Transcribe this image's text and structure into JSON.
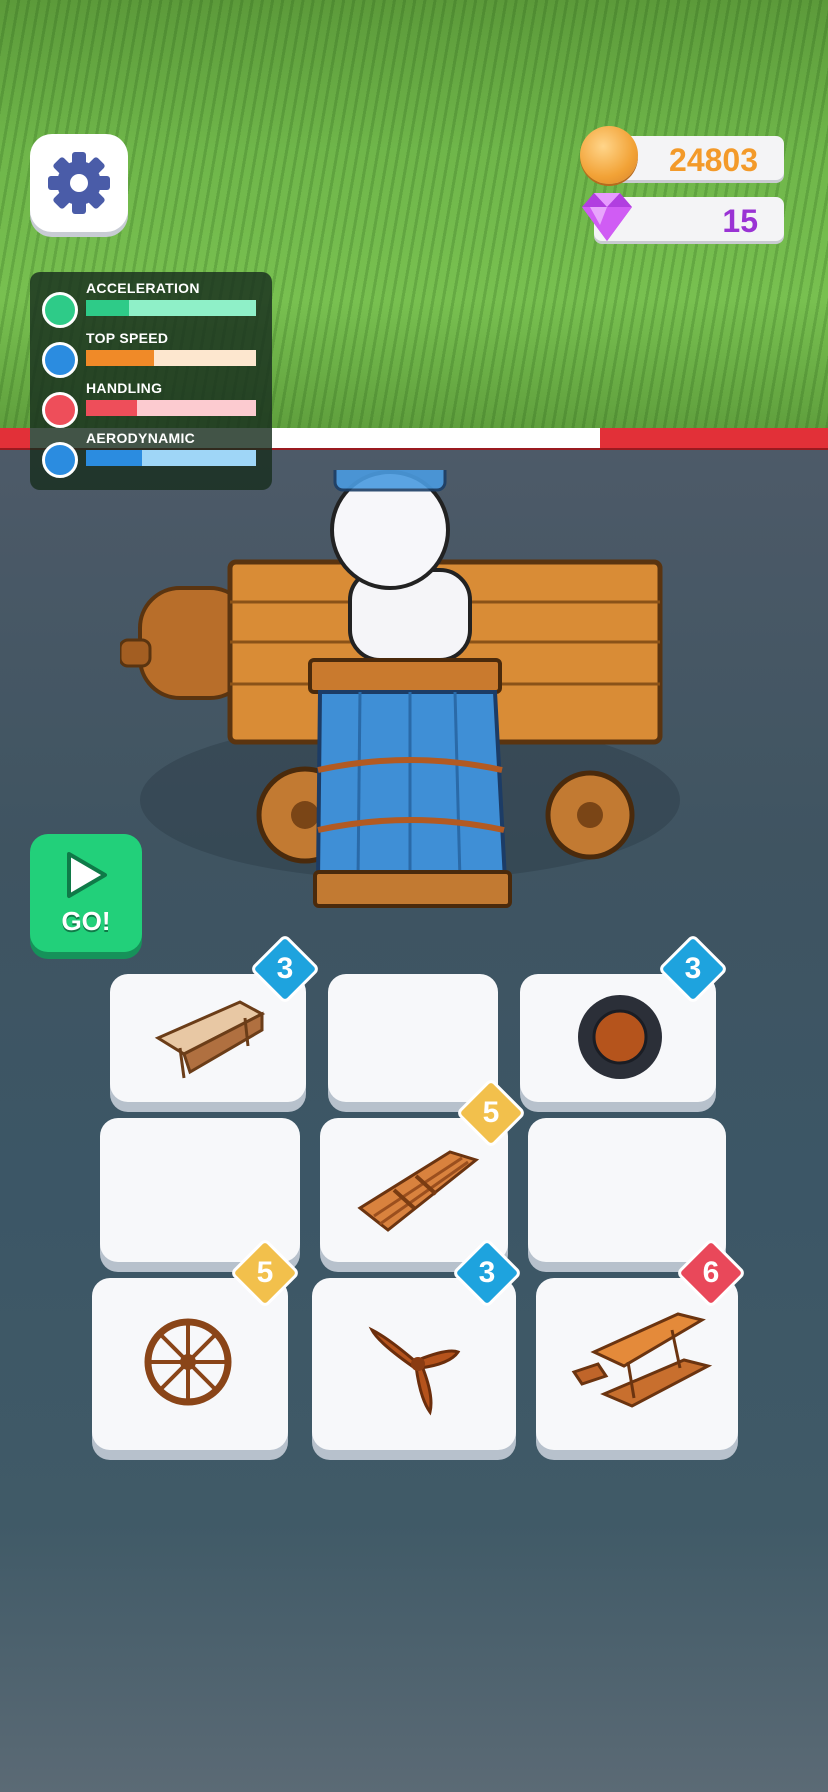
{
  "currency": {
    "coins": "24803",
    "gems": "15"
  },
  "stats": [
    {
      "label": "ACCELERATION",
      "level": 0.25,
      "color": "#2ecb88",
      "track": "#8ff0c8",
      "icon": "gauge-icon"
    },
    {
      "label": "TOP SPEED",
      "level": 0.4,
      "color": "#f08a28",
      "track": "#fde7cf",
      "icon": "wheel-icon"
    },
    {
      "label": "HANDLING",
      "level": 0.3,
      "color": "#ee4e5a",
      "track": "#fccbd0",
      "icon": "magnet-icon"
    },
    {
      "label": "AERODYNAMIC",
      "level": 0.33,
      "color": "#2b8ce0",
      "track": "#9fd6f7",
      "icon": "paper-plane-icon"
    }
  ],
  "go_button": {
    "label": "GO!"
  },
  "grid": [
    {
      "item": "wooden-wing-part",
      "level": "3",
      "badge": "blue"
    },
    {
      "item": null,
      "level": null
    },
    {
      "item": "rubber-tire",
      "level": "3",
      "badge": "blue"
    },
    {
      "item": null,
      "level": null
    },
    {
      "item": "wooden-plank-wing",
      "level": "5",
      "badge": "orange"
    },
    {
      "item": null,
      "level": null
    },
    {
      "item": "wooden-wheel",
      "level": "5",
      "badge": "orange"
    },
    {
      "item": "propeller",
      "level": "3",
      "badge": "blue"
    },
    {
      "item": "biplane-wing",
      "level": "6",
      "badge": "red"
    }
  ]
}
